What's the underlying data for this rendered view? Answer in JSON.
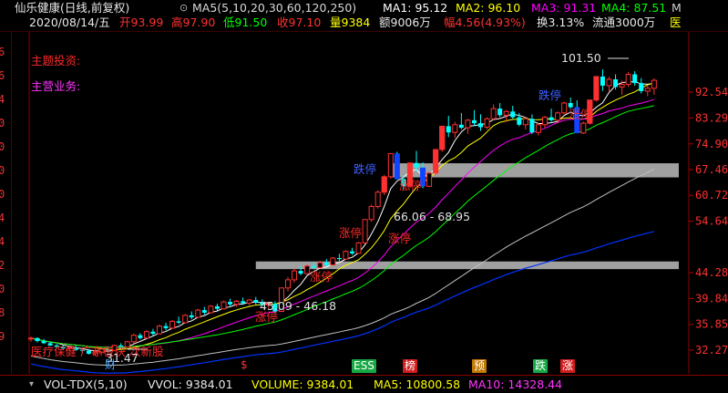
{
  "header": {
    "title": "仙乐健康(日线,前复权)",
    "ma_params": "MA5(5,10,20,30,60,120,250)",
    "ma1": "MA1: 95.12",
    "ma2": "MA2: 96.10",
    "ma3": "MA3: 91.31",
    "ma4": "MA4: 87.51",
    "ma_more": "M",
    "date": "2020/08/14/五",
    "open": "开93.99",
    "high": "高97.90",
    "low": "低91.50",
    "close": "收97.10",
    "volume": "量9384",
    "amount": "额9006万",
    "change": "幅4.56(4.93%)",
    "turnover": "换3.13%",
    "float": "流通3000万",
    "more": "医"
  },
  "annotations": {
    "theme": "主题投资:",
    "business": "主营业务:",
    "sector": "医疗保健 广东板块 次新股",
    "high_mark": "101.50",
    "low_mark": "31.47",
    "range1": "66.06 - 68.95",
    "range2": "45.09 - 46.18",
    "zt_labels": [
      "涨停",
      "涨停",
      "涨停",
      "涨停",
      "涨停",
      "涨停"
    ],
    "dt_labels": [
      "跌停",
      "跌停"
    ],
    "events": [
      "财",
      "$",
      "ESS",
      "榜",
      "预",
      "跌",
      "涨"
    ]
  },
  "price_axis": [
    "92.54",
    "83.29",
    "74.90",
    "67.46",
    "60.72",
    "54.64",
    "44.28",
    "39.84",
    "35.85",
    "32.27"
  ],
  "left_edge": [
    "6",
    "6",
    "4",
    "0",
    "0",
    "0",
    "0",
    "4",
    "4",
    "2",
    "0",
    "8",
    "9"
  ],
  "bottom": {
    "indicator": "VOL-TDX(5,10)",
    "vvol": "VVOL: 9384.01",
    "volume": "VOLUME: 9384.01",
    "ma5": "MA5: 10800.58",
    "ma10": "MA10: 14328.44"
  },
  "colors": {
    "up": "#ff3030",
    "down": "#00ffff",
    "ma1": "#ffffff",
    "ma2": "#ffff00",
    "ma3": "#ff00ff",
    "ma4": "#00ff00",
    "ma5": "#c0c0c0",
    "ma6": "#0033ff",
    "band": "#a0a0a0"
  },
  "chart_data": {
    "type": "candlestick",
    "title": "仙乐健康(日线,前复权)",
    "y_ticks": [
      32.27,
      35.85,
      39.84,
      44.28,
      54.64,
      60.72,
      67.46,
      74.9,
      83.29,
      92.54
    ],
    "log_scale": true,
    "candles": [
      [
        33.8,
        34.1,
        33.4,
        33.9
      ],
      [
        33.9,
        34.0,
        33.3,
        33.5
      ],
      [
        33.5,
        33.8,
        33.1,
        33.2
      ],
      [
        33.2,
        33.4,
        32.8,
        32.9
      ],
      [
        32.9,
        33.1,
        32.5,
        32.7
      ],
      [
        32.7,
        32.9,
        32.3,
        32.5
      ],
      [
        32.5,
        32.8,
        32.1,
        32.6
      ],
      [
        32.6,
        32.9,
        32.2,
        32.3
      ],
      [
        32.3,
        32.6,
        31.9,
        32.2
      ],
      [
        32.2,
        32.4,
        31.7,
        31.8
      ],
      [
        31.8,
        32.2,
        31.5,
        32.0
      ],
      [
        32.0,
        32.6,
        31.8,
        32.4
      ],
      [
        32.4,
        32.8,
        32.0,
        32.2
      ],
      [
        32.2,
        33.0,
        32.1,
        32.9
      ],
      [
        32.9,
        33.2,
        32.5,
        32.7
      ],
      [
        32.7,
        33.5,
        32.6,
        33.4
      ],
      [
        33.4,
        34.5,
        33.2,
        34.3
      ],
      [
        34.3,
        34.6,
        33.7,
        33.9
      ],
      [
        33.9,
        35.0,
        33.8,
        34.8
      ],
      [
        34.8,
        35.2,
        34.2,
        34.5
      ],
      [
        34.5,
        35.8,
        34.4,
        35.6
      ],
      [
        35.6,
        36.1,
        35.0,
        35.3
      ],
      [
        35.3,
        36.5,
        35.2,
        36.3
      ],
      [
        36.3,
        37.0,
        35.9,
        36.1
      ],
      [
        36.1,
        37.4,
        36.0,
        37.2
      ],
      [
        37.2,
        37.8,
        36.6,
        36.9
      ],
      [
        36.9,
        38.2,
        36.8,
        38.0
      ],
      [
        38.0,
        38.5,
        37.3,
        37.6
      ],
      [
        37.6,
        38.8,
        37.5,
        38.6
      ],
      [
        38.6,
        39.0,
        37.9,
        38.2
      ],
      [
        38.2,
        39.5,
        38.1,
        39.3
      ],
      [
        39.3,
        39.8,
        38.6,
        38.9
      ],
      [
        38.9,
        39.6,
        38.5,
        39.4
      ],
      [
        39.4,
        40.0,
        38.8,
        39.1
      ],
      [
        39.1,
        39.8,
        38.7,
        39.6
      ],
      [
        39.6,
        40.1,
        38.9,
        39.2
      ],
      [
        39.2,
        39.7,
        38.6,
        38.8
      ],
      [
        38.8,
        39.3,
        38.2,
        39.0
      ],
      [
        39.0,
        39.4,
        37.5,
        37.8
      ],
      [
        37.8,
        41.6,
        37.7,
        41.6
      ],
      [
        41.6,
        43.5,
        41.0,
        43.0
      ],
      [
        43.0,
        45.0,
        42.5,
        44.6
      ],
      [
        44.6,
        45.5,
        43.8,
        44.1
      ],
      [
        44.1,
        45.8,
        43.9,
        45.5
      ],
      [
        45.5,
        46.2,
        44.9,
        45.2
      ],
      [
        45.2,
        46.5,
        45.0,
        46.1
      ],
      [
        46.1,
        46.8,
        45.4,
        45.7
      ],
      [
        45.7,
        47.2,
        45.6,
        47.0
      ],
      [
        47.0,
        47.8,
        46.4,
        46.8
      ],
      [
        46.8,
        48.5,
        46.7,
        48.3
      ],
      [
        48.3,
        49.0,
        47.6,
        47.9
      ],
      [
        47.9,
        50.2,
        47.8,
        50.0
      ],
      [
        50.0,
        55.0,
        49.8,
        55.0
      ],
      [
        55.0,
        58.5,
        54.5,
        58.0
      ],
      [
        58.0,
        62.0,
        57.5,
        61.5
      ],
      [
        61.5,
        66.0,
        60.8,
        65.5
      ],
      [
        65.5,
        72.0,
        65.0,
        72.0
      ],
      [
        72.0,
        72.5,
        64.8,
        64.9
      ],
      [
        64.9,
        66.0,
        62.0,
        63.0
      ],
      [
        63.0,
        69.3,
        62.5,
        69.3
      ],
      [
        69.3,
        72.8,
        67.0,
        68.0
      ],
      [
        68.0,
        69.5,
        62.5,
        63.0
      ],
      [
        63.0,
        66.8,
        62.8,
        66.5
      ],
      [
        66.5,
        73.2,
        66.0,
        73.2
      ],
      [
        73.2,
        80.5,
        72.5,
        80.5
      ],
      [
        80.5,
        84.0,
        77.0,
        78.5
      ],
      [
        78.5,
        82.0,
        76.8,
        81.0
      ],
      [
        81.0,
        85.0,
        79.5,
        80.0
      ],
      [
        80.0,
        83.0,
        78.0,
        82.5
      ],
      [
        82.5,
        86.0,
        80.5,
        81.5
      ],
      [
        81.5,
        84.5,
        79.0,
        80.2
      ],
      [
        80.2,
        83.5,
        79.5,
        83.0
      ],
      [
        83.0,
        88.0,
        82.5,
        86.5
      ],
      [
        86.5,
        88.5,
        83.5,
        84.2
      ],
      [
        84.2,
        86.0,
        82.0,
        85.5
      ],
      [
        85.5,
        87.5,
        83.0,
        83.5
      ],
      [
        83.5,
        85.0,
        80.5,
        81.0
      ],
      [
        81.0,
        83.5,
        79.5,
        83.0
      ],
      [
        83.0,
        84.5,
        78.0,
        78.5
      ],
      [
        78.5,
        81.5,
        77.5,
        81.0
      ],
      [
        81.0,
        84.0,
        80.0,
        83.5
      ],
      [
        83.5,
        86.5,
        82.0,
        82.5
      ],
      [
        82.5,
        85.5,
        81.5,
        85.0
      ],
      [
        85.0,
        89.0,
        84.5,
        88.5
      ],
      [
        88.5,
        90.5,
        86.5,
        87.0
      ],
      [
        87.0,
        89.5,
        78.3,
        78.3
      ],
      [
        78.3,
        82.0,
        78.0,
        81.5
      ],
      [
        81.5,
        89.6,
        81.0,
        89.6
      ],
      [
        89.6,
        98.6,
        89.0,
        98.6
      ],
      [
        98.6,
        101.5,
        93.0,
        95.0
      ],
      [
        95.0,
        98.5,
        92.5,
        97.5
      ],
      [
        97.5,
        99.5,
        93.5,
        94.5
      ],
      [
        94.5,
        97.0,
        91.5,
        95.5
      ],
      [
        95.5,
        100.5,
        94.5,
        99.5
      ],
      [
        99.5,
        100.8,
        95.0,
        96.0
      ],
      [
        96.0,
        98.0,
        92.0,
        92.9
      ],
      [
        92.9,
        95.0,
        91.0,
        93.99
      ],
      [
        93.99,
        97.9,
        91.5,
        97.1
      ]
    ],
    "ma_lines": [
      {
        "name": "MA1",
        "color": "#ffffff",
        "end": 95.12
      },
      {
        "name": "MA2",
        "color": "#ffff00",
        "end": 96.1
      },
      {
        "name": "MA3",
        "color": "#ff00ff",
        "end": 91.31
      },
      {
        "name": "MA4",
        "color": "#00ff00",
        "end": 87.51
      }
    ],
    "bands": [
      [
        66.06,
        68.95
      ],
      [
        45.09,
        46.18
      ]
    ]
  }
}
